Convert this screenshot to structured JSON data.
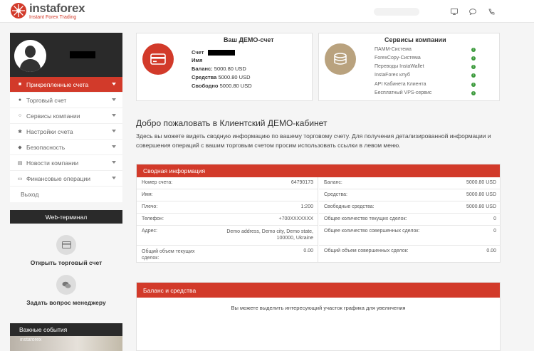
{
  "header": {
    "logo_name": "instaforex",
    "logo_tagline": "Instant Forex Trading",
    "icons": [
      "monitor-icon",
      "chat-icon",
      "phone-icon"
    ]
  },
  "sidebar": {
    "menu": [
      {
        "label": "Прикрепленные счета",
        "icon": "document-icon",
        "active": true
      },
      {
        "label": "Торговый счет",
        "icon": "user-icon"
      },
      {
        "label": "Сервисы компании",
        "icon": "search-icon"
      },
      {
        "label": "Настройки счета",
        "icon": "gear-icon"
      },
      {
        "label": "Безопасность",
        "icon": "shield-icon"
      },
      {
        "label": "Новости компании",
        "icon": "newspaper-icon"
      },
      {
        "label": "Финансовые операции",
        "icon": "wallet-icon"
      }
    ],
    "logout": "Выход",
    "web_terminal": "Web-терминал",
    "open_account": "Открыть торговый счет",
    "ask_manager": "Задать вопрос менеджеру",
    "events": "Важные события",
    "events_watermark": "instaforex"
  },
  "demo_card": {
    "title": "Ваш ДЕМО-счет",
    "account_label": "Счет",
    "name_label": "Имя",
    "balance_label": "Баланс:",
    "balance_value": "5000.80 USD",
    "equity_label": "Средства",
    "equity_value": "5000.80 USD",
    "free_label": "Свободно",
    "free_value": "5000.80 USD"
  },
  "services_card": {
    "title": "Сервисы компании",
    "items": [
      "ПАММ-Система",
      "ForexCopy-Система",
      "Переводы InstaWallet",
      "InstaForex клуб",
      "API Кабинета Клиента",
      "Бесплатный VPS-сервис"
    ]
  },
  "welcome": {
    "title": "Добро пожаловать в Клиентский ДЕМО-кабинет",
    "text": "Здесь вы можете видеть сводную информацию по вашему торговому счету. Для получения детализированной информации и совершения операций с вашим торговым счетом просим использовать ссылки в левом меню."
  },
  "summary": {
    "title": "Сводная информация",
    "left": [
      {
        "key": "Номер счета:",
        "value": "64790173"
      },
      {
        "key": "Имя:",
        "value": ""
      },
      {
        "key": "Плечо:",
        "value": "1:200"
      },
      {
        "key": "Телефон:",
        "value": "+700XXXXXXX"
      },
      {
        "key": "Адрес:",
        "value": "Demo address, Demo city, Demo state, 100000, Ukraine"
      },
      {
        "key": "Общий объем текущих сделок:",
        "value": "0.00"
      }
    ],
    "right": [
      {
        "key": "Баланс:",
        "value": "5000.80 USD"
      },
      {
        "key": "Средства:",
        "value": "5000.80 USD"
      },
      {
        "key": "Свободные средства:",
        "value": "5000.80 USD"
      },
      {
        "key": "Общее количество текущих сделок:",
        "value": "0"
      },
      {
        "key": "Общее количество совершенных сделок:",
        "value": "0"
      },
      {
        "key": "Общий объем совершенных сделок:",
        "value": "0.00"
      }
    ]
  },
  "balance_panel": {
    "title": "Баланс и средства",
    "note": "Вы можете выделить интересующий участок графика для увеличения"
  }
}
